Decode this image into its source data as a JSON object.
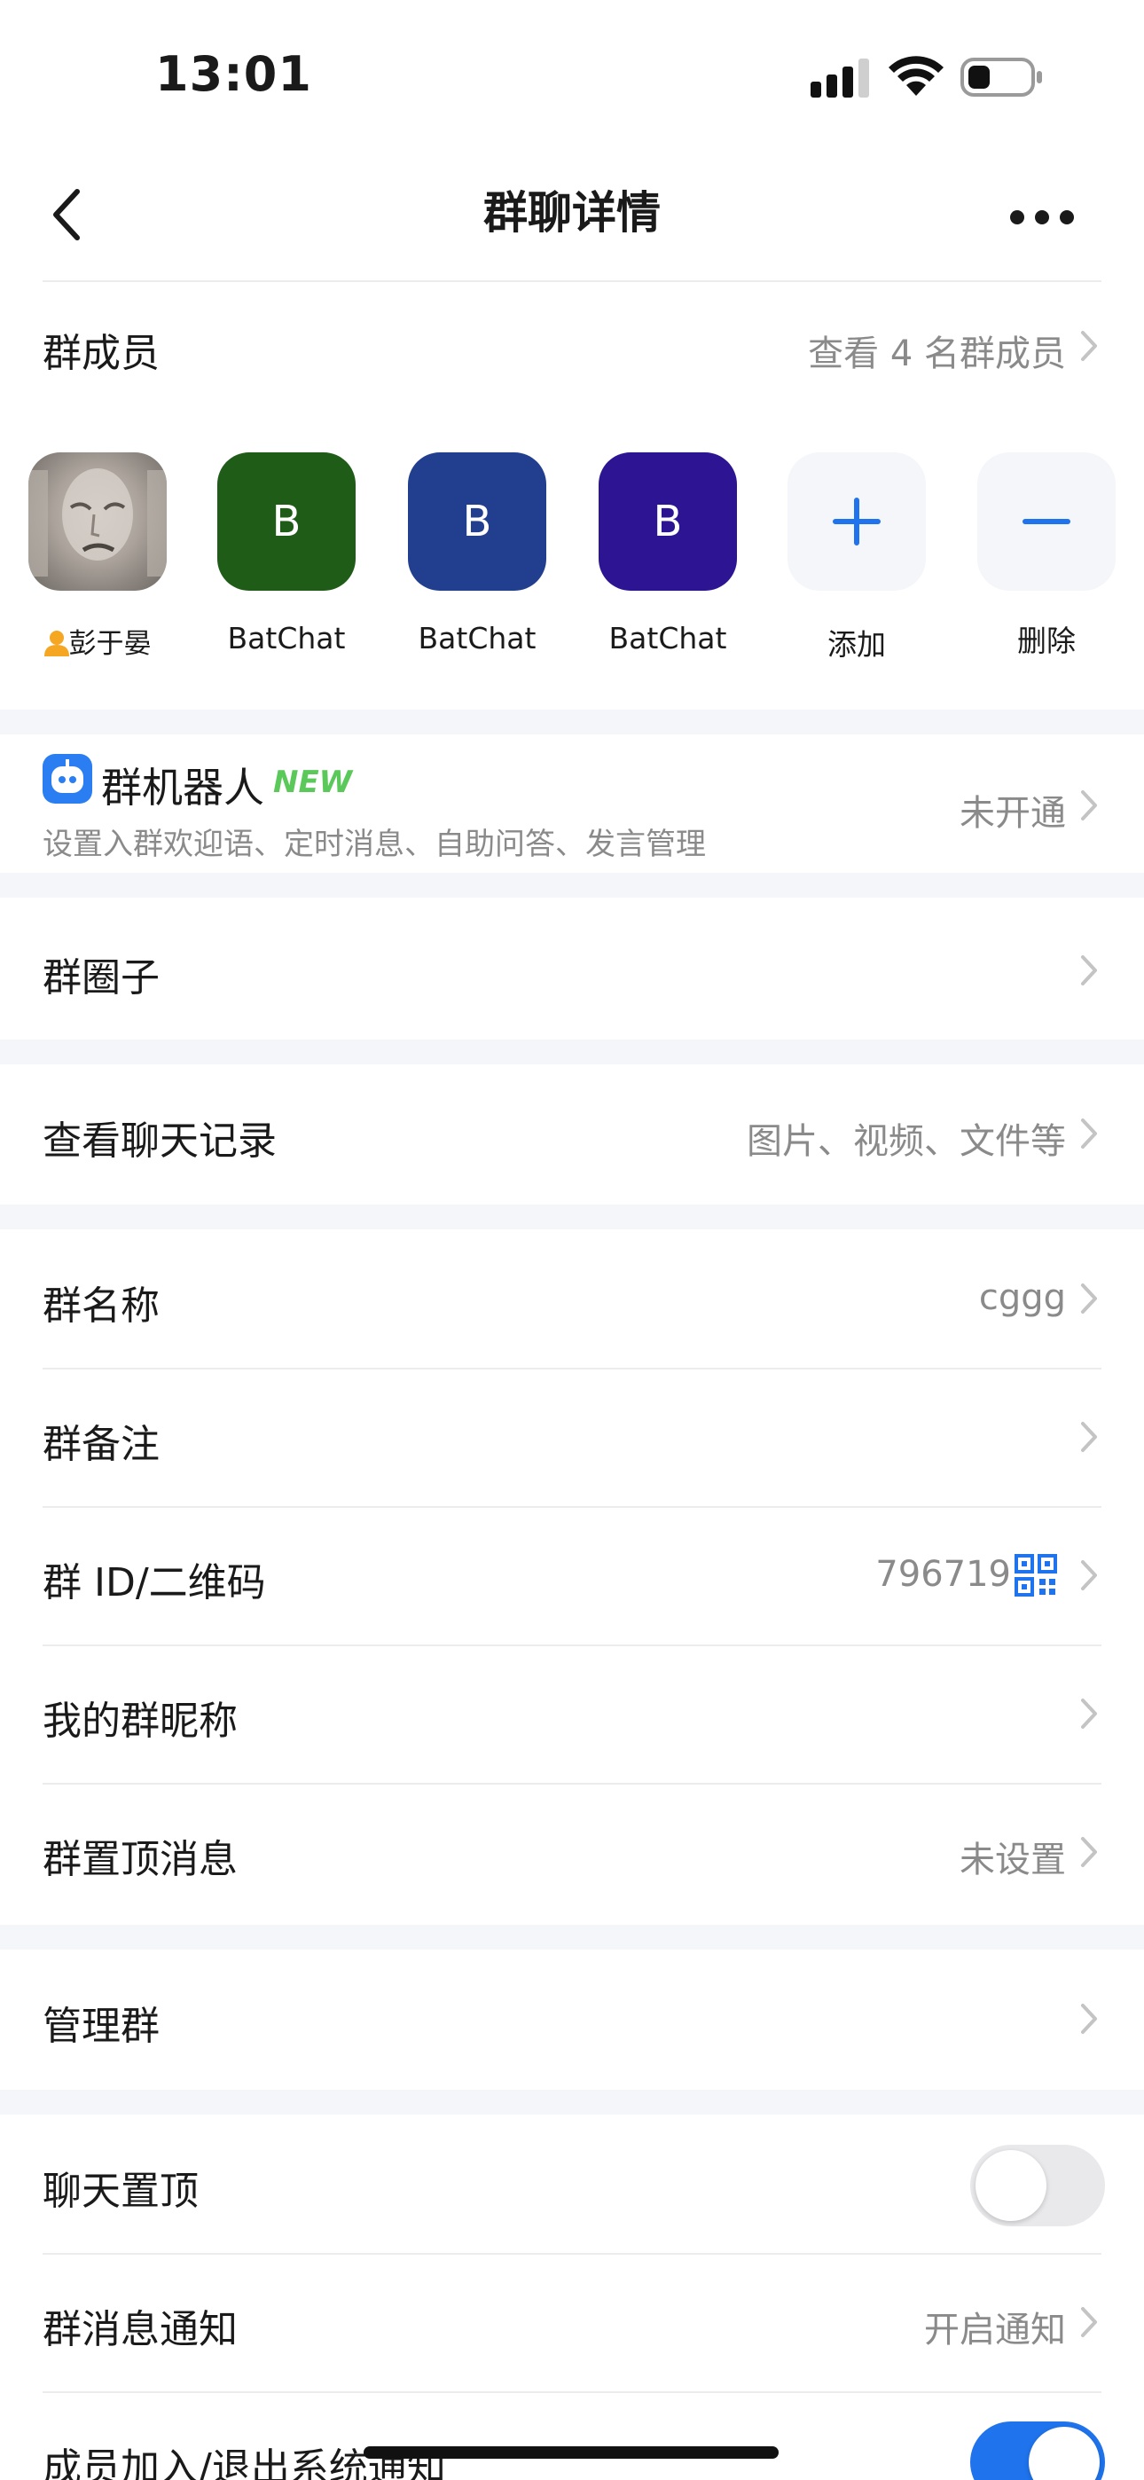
{
  "status_bar": {
    "time": "13:01"
  },
  "nav": {
    "title": "群聊详情"
  },
  "members": {
    "label": "群成员",
    "view_all": "查看 4 名群成员",
    "list": [
      {
        "name": "彭于晏",
        "initial": "",
        "color": ""
      },
      {
        "name": "BatChat",
        "initial": "B",
        "color": "#1f5c17"
      },
      {
        "name": "BatChat",
        "initial": "B",
        "color": "#223e8f"
      },
      {
        "name": "BatChat",
        "initial": "B",
        "color": "#2c1493"
      }
    ],
    "add_label": "添加",
    "remove_label": "删除"
  },
  "robot": {
    "title": "群机器人",
    "badge": "NEW",
    "subtitle": "设置入群欢迎语、定时消息、自助问答、发言管理",
    "value": "未开通"
  },
  "circle": {
    "label": "群圈子"
  },
  "history": {
    "label": "查看聊天记录",
    "value": "图片、视频、文件等"
  },
  "info": {
    "name_label": "群名称",
    "name_value": "cggg",
    "remark_label": "群备注",
    "id_label": "群 ID/二维码",
    "id_value": "796719",
    "nickname_label": "我的群昵称",
    "pinned_label": "群置顶消息",
    "pinned_value": "未设置"
  },
  "manage": {
    "label": "管理群"
  },
  "settings": {
    "pin_chat_label": "聊天置顶",
    "pin_chat_on": false,
    "notify_label": "群消息通知",
    "notify_value": "开启通知",
    "member_notice_label": "成员加入/退出系统通知",
    "member_notice_on": true
  },
  "colors": {
    "accent": "#1f73ec",
    "new_badge": "#5bc85a",
    "gap": "#f4f6fa"
  }
}
